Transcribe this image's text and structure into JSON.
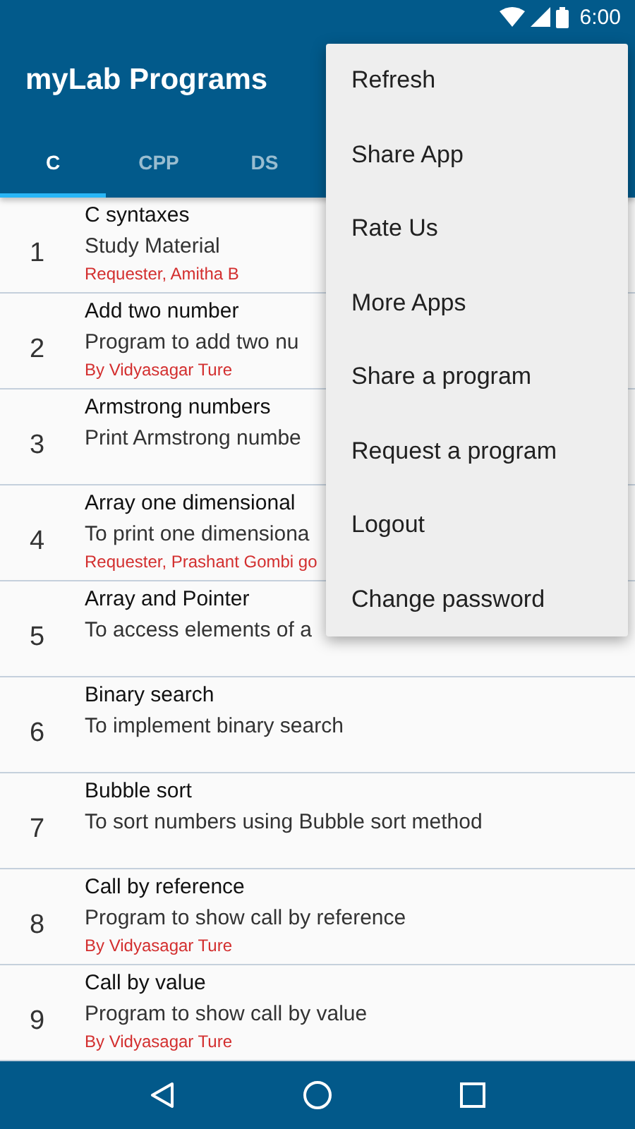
{
  "status_bar": {
    "time": "6:00"
  },
  "app_bar": {
    "title": "myLab Programs"
  },
  "tabs": [
    {
      "label": "C",
      "selected": true
    },
    {
      "label": "CPP",
      "selected": false
    },
    {
      "label": "DS",
      "selected": false
    }
  ],
  "programs": [
    {
      "number": "1",
      "title": "C syntaxes",
      "description": "Study Material",
      "author": "Requester, Amitha B"
    },
    {
      "number": "2",
      "title": "Add two number",
      "description": "Program to add two nu",
      "author": "By Vidyasagar Ture"
    },
    {
      "number": "3",
      "title": "Armstrong numbers",
      "description": "Print Armstrong numbe"
    },
    {
      "number": "4",
      "title": "Array one dimensional",
      "description": "To print one dimensiona",
      "author": "Requester, Prashant Gombi go"
    },
    {
      "number": "5",
      "title": "Array and Pointer",
      "description": "To access elements of a"
    },
    {
      "number": "6",
      "title": "Binary search",
      "description": "To implement binary search"
    },
    {
      "number": "7",
      "title": "Bubble sort",
      "description": "To sort numbers using Bubble sort method"
    },
    {
      "number": "8",
      "title": "Call by reference",
      "description": "Program to show call by reference",
      "author": "By Vidyasagar Ture"
    },
    {
      "number": "9",
      "title": "Call by value",
      "description": "Program to show call by value",
      "author": "By Vidyasagar Ture"
    }
  ],
  "menu": {
    "items": [
      "Refresh",
      "Share App",
      "Rate Us",
      "More Apps",
      "Share a program",
      "Request a program",
      "Logout",
      "Change password"
    ]
  }
}
